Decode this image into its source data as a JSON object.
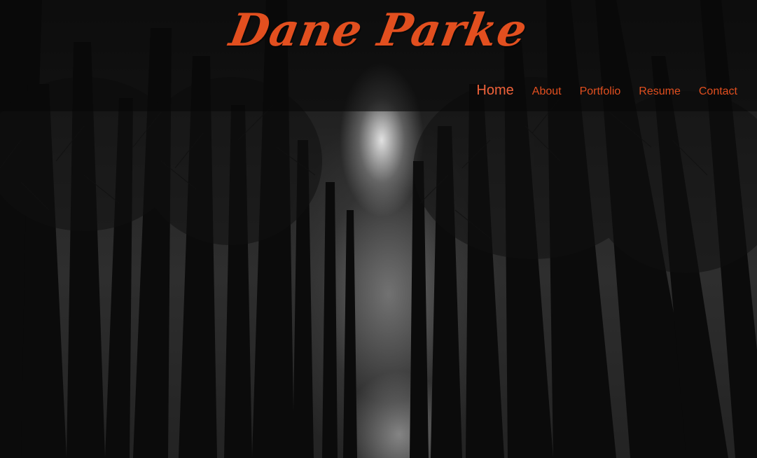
{
  "brand": {
    "name": "Dane Parke",
    "color": "#e24f1f"
  },
  "nav": {
    "items": [
      {
        "label": "Home",
        "active": true
      },
      {
        "label": "About",
        "active": false
      },
      {
        "label": "Portfolio",
        "active": false
      },
      {
        "label": "Resume",
        "active": false
      },
      {
        "label": "Contact",
        "active": false
      }
    ]
  },
  "hero": {
    "image": "dark-forest-background"
  }
}
